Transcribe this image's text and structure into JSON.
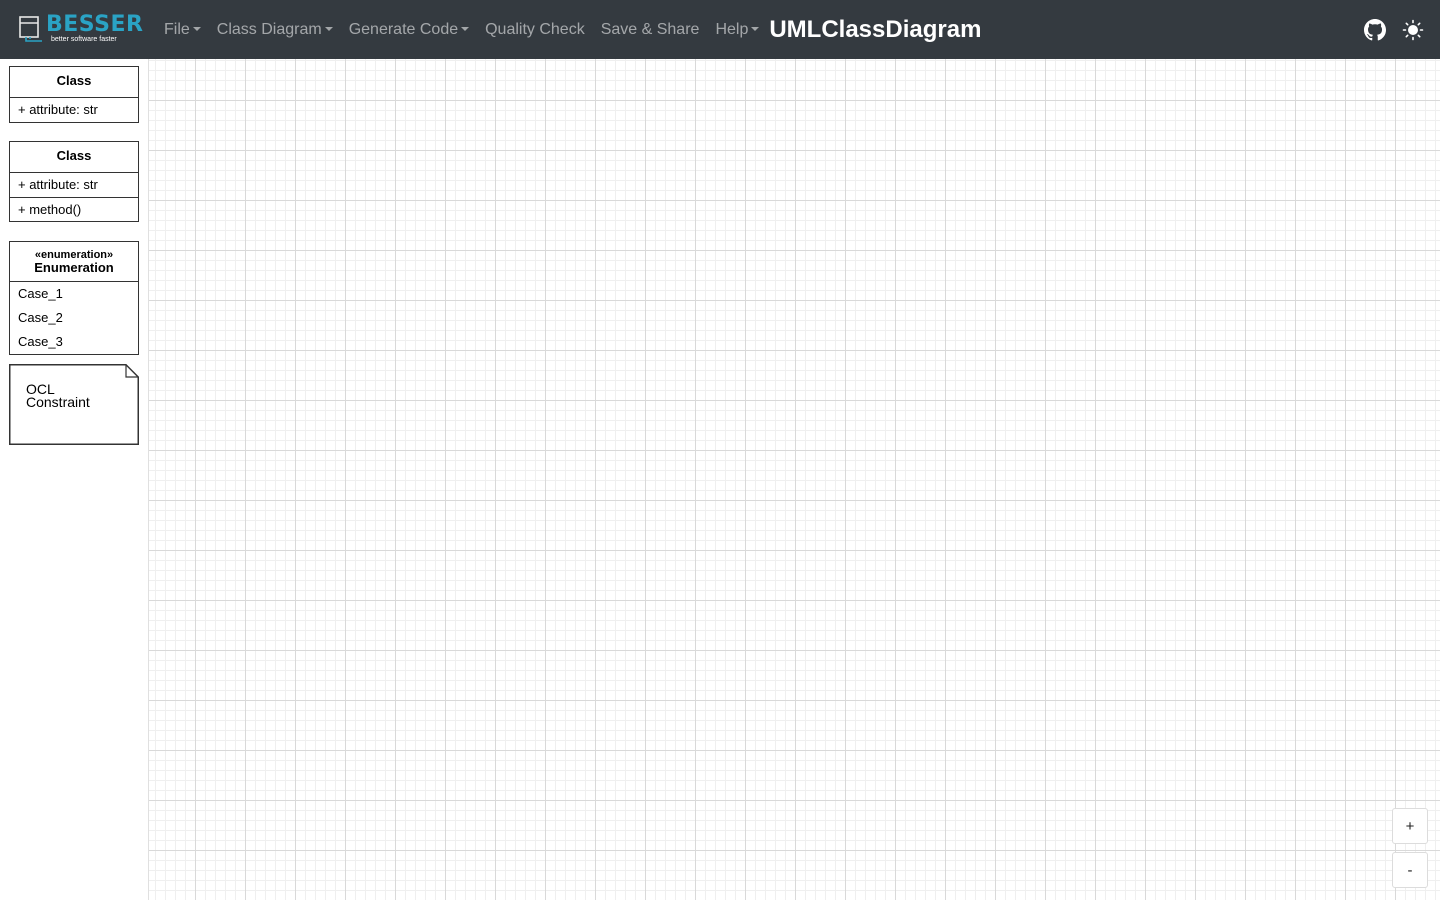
{
  "brand": {
    "name": "BESSER",
    "tagline": "better software faster",
    "accent_color": "#2aa3c5",
    "icon": "besser-logo-icon"
  },
  "nav": {
    "menu": [
      {
        "label": "File",
        "dropdown": true
      },
      {
        "label": "Class Diagram",
        "dropdown": true
      },
      {
        "label": "Generate Code",
        "dropdown": true
      },
      {
        "label": "Quality Check",
        "dropdown": false
      },
      {
        "label": "Save & Share",
        "dropdown": false
      },
      {
        "label": "Help",
        "dropdown": true
      }
    ],
    "title": "UMLClassDiagram",
    "icons": [
      "github-icon",
      "theme-toggle-icon"
    ]
  },
  "palette": {
    "class_simple": {
      "name": "Class",
      "attributes": [
        "+ attribute: str"
      ]
    },
    "class_full": {
      "name": "Class",
      "attributes": [
        "+ attribute: str"
      ],
      "methods": [
        "+ method()"
      ]
    },
    "enumeration": {
      "stereotype": "«enumeration»",
      "name": "Enumeration",
      "cases": [
        "Case_1",
        "Case_2",
        "Case_3"
      ]
    },
    "ocl": {
      "text": "OCL Constraint"
    }
  },
  "zoom": {
    "in_label": "+",
    "out_label": "-"
  },
  "colors": {
    "navbar": "#343a40",
    "title": "#ffffff",
    "nav_text": "rgba(255,255,255,0.55)"
  }
}
